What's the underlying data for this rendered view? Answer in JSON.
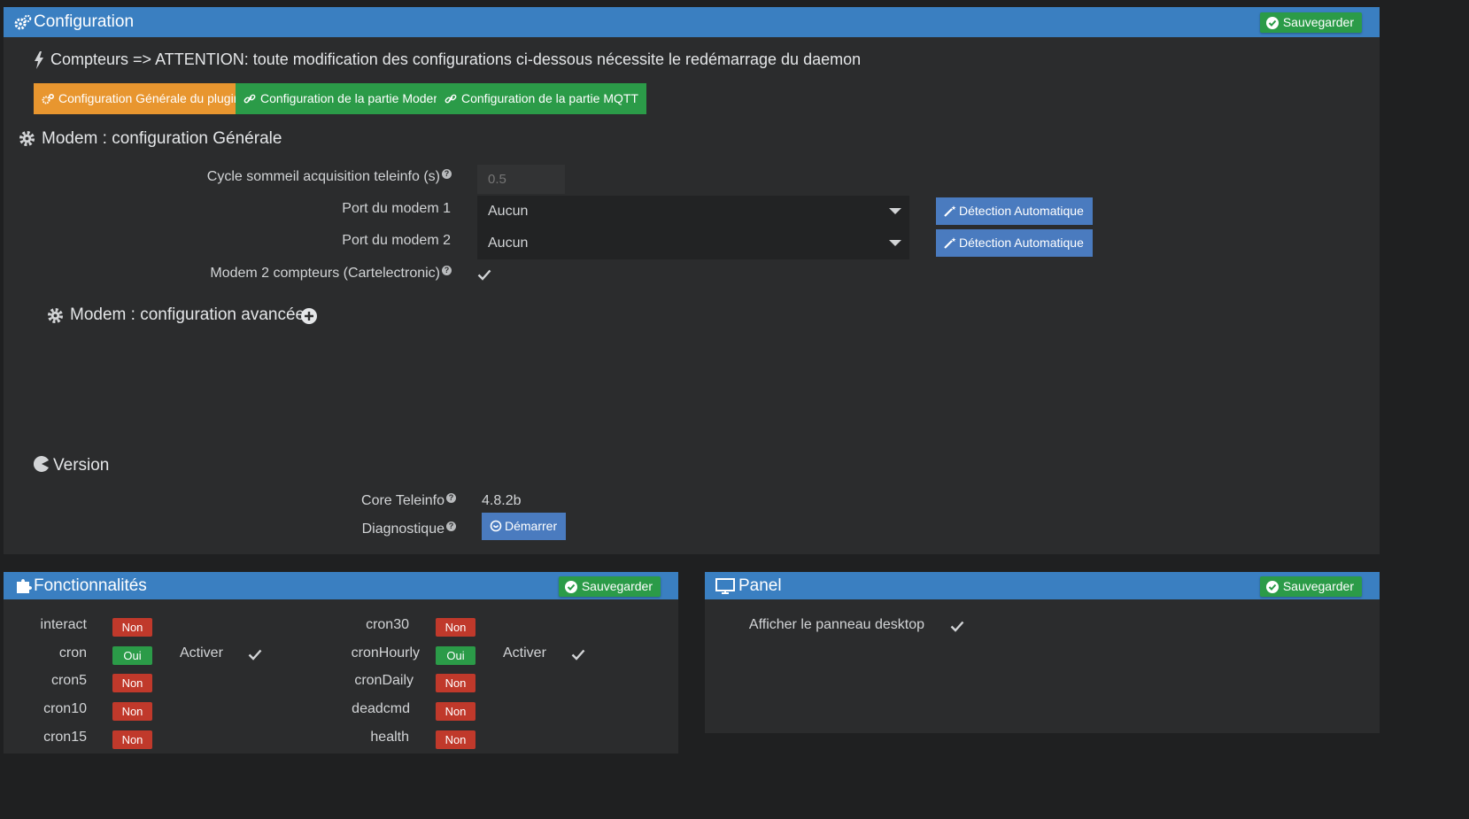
{
  "config_panel": {
    "title": "Configuration",
    "save_label": "Sauvegarder",
    "warning": "Compteurs => ATTENTION: toute modification des configurations ci-dessous nécessite le redémarrage du daemon",
    "tabs": [
      {
        "label": "Configuration Générale du plugin",
        "color": "#e8962f"
      },
      {
        "label": "Configuration de la partie Modem",
        "color": "#2b9b48"
      },
      {
        "label": "Configuration de la partie MQTT",
        "color": "#2b9b48"
      }
    ],
    "modem_general": {
      "title": "Modem : configuration Générale",
      "cycle_label": "Cycle sommeil acquisition teleinfo (s)",
      "cycle_placeholder": "0.5",
      "port1_label": "Port du modem 1",
      "port1_value": "Aucun",
      "port2_label": "Port du modem 2",
      "port2_value": "Aucun",
      "detect_label": "Détection Automatique",
      "modem2_label": "Modem 2 compteurs (Cartelectronic)",
      "modem2_checked": true
    },
    "modem_advanced_title": "Modem : configuration avancée",
    "version": {
      "title": "Version",
      "core_label": "Core Teleinfo",
      "core_value": "4.8.2b",
      "diag_label": "Diagnostique",
      "start_label": "Démarrer"
    }
  },
  "features_panel": {
    "title": "Fonctionnalités",
    "save_label": "Sauvegarder",
    "activate_label": "Activer",
    "left": [
      {
        "name": "interact",
        "status": "Non"
      },
      {
        "name": "cron",
        "status": "Oui",
        "activate": true
      },
      {
        "name": "cron5",
        "status": "Non"
      },
      {
        "name": "cron10",
        "status": "Non"
      },
      {
        "name": "cron15",
        "status": "Non"
      }
    ],
    "right": [
      {
        "name": "cron30",
        "status": "Non"
      },
      {
        "name": "cronHourly",
        "status": "Oui",
        "activate": true
      },
      {
        "name": "cronDaily",
        "status": "Non"
      },
      {
        "name": "deadcmd",
        "status": "Non"
      },
      {
        "name": "health",
        "status": "Non"
      }
    ]
  },
  "panel_panel": {
    "title": "Panel",
    "save_label": "Sauvegarder",
    "desktop_label": "Afficher le panneau desktop",
    "desktop_checked": true
  },
  "colors": {
    "header_blue": "#3a7fc1",
    "save_green": "#2b9b48",
    "non_red": "#c0392b",
    "tab_orange": "#e8962f",
    "button_blue": "#4a7bbf"
  }
}
